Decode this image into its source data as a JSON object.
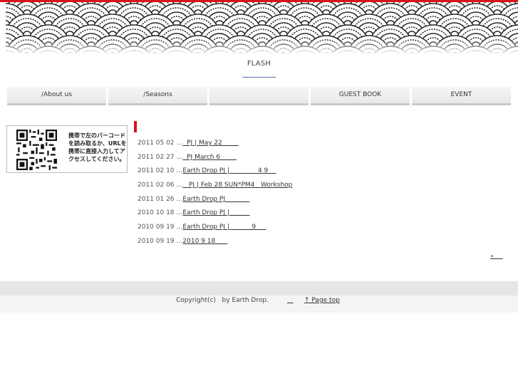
{
  "header": {
    "flash_label": "FLASH"
  },
  "nav": {
    "items": [
      {
        "label": "/About us"
      },
      {
        "label": "/Seasons"
      },
      {
        "label": ""
      },
      {
        "label": "GUEST BOOK"
      },
      {
        "label": "EVENT"
      }
    ]
  },
  "qr": {
    "icon": "qr-code-icon",
    "text": "携帯で左のバーコードを読み取るか、URLを携帯に直接入力してアクセスしてください。"
  },
  "news": [
    {
      "date": "2011 05 02 …",
      "title": "  PJ | May 22        "
    },
    {
      "date": "2011 02 27 …",
      "title": "  PJ March 6        "
    },
    {
      "date": "2011 02 10 …",
      "title": "Earth Drop PJ |              4 9    "
    },
    {
      "date": "2011 02 06 …",
      "title": "   PJ | Feb 28 SUN*PM4   Workshop"
    },
    {
      "date": "2011 01 26 …",
      "title": "Earth Drop PJ            "
    },
    {
      "date": "2010 10 18 …",
      "title": "Earth Drop PJ |          "
    },
    {
      "date": "2010 09 19 …",
      "title": "Earth Drop PJ |           9     "
    },
    {
      "date": "2010 09 19 …",
      "title": "2010 9 18      "
    }
  ],
  "more_link": "»     ",
  "footer": {
    "copyright": "Copyright(c)   by Earth Drop.",
    "link_blank": "   ",
    "page_top": "↑ Page top"
  },
  "colors": {
    "accent_red": "#d7141a",
    "flash_underline": "#5a6ca8"
  }
}
